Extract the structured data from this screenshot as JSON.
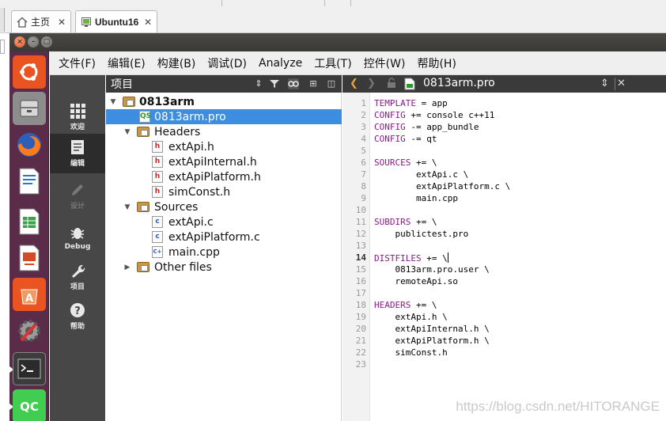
{
  "host_tabs": [
    {
      "label": "主页",
      "icon": "home-icon"
    },
    {
      "label": "Ubuntu16",
      "icon": "vm-icon"
    }
  ],
  "launcher": [
    {
      "name": "ubuntu-dash-icon",
      "color": "#e95420"
    },
    {
      "name": "files-icon",
      "color": "#8a8a8a"
    },
    {
      "name": "firefox-icon",
      "color": "#ff7b1b"
    },
    {
      "name": "writer-icon",
      "color": "#2a77c9"
    },
    {
      "name": "calc-icon",
      "color": "#3aa34a"
    },
    {
      "name": "impress-icon",
      "color": "#d44b2a"
    },
    {
      "name": "software-center-icon",
      "color": "#e95420"
    },
    {
      "name": "system-settings-icon",
      "color": "#9a9a9a"
    },
    {
      "name": "terminal-icon",
      "color": "#2b2b2b"
    },
    {
      "name": "qtcreator-icon",
      "color": "#41cd52"
    }
  ],
  "menu": [
    "文件(F)",
    "编辑(E)",
    "构建(B)",
    "调试(D)",
    "Analyze",
    "工具(T)",
    "控件(W)",
    "帮助(H)"
  ],
  "modes": [
    {
      "label": "欢迎",
      "icon": "welcome-grid-icon",
      "state": "normal"
    },
    {
      "label": "编辑",
      "icon": "edit-document-icon",
      "state": "active"
    },
    {
      "label": "设计",
      "icon": "design-pencil-icon",
      "state": "disabled"
    },
    {
      "label": "Debug",
      "icon": "debug-bug-icon",
      "state": "normal"
    },
    {
      "label": "项目",
      "icon": "projects-wrench-icon",
      "state": "normal"
    },
    {
      "label": "帮助",
      "icon": "help-question-icon",
      "state": "normal"
    }
  ],
  "project_pane": {
    "title": "项目"
  },
  "tree": [
    {
      "label": "0813arm",
      "kind": "project",
      "expanded": true,
      "bold": true
    },
    {
      "label": "0813arm.pro",
      "kind": "pro-file",
      "selected": true
    },
    {
      "label": "Headers",
      "kind": "folder",
      "expanded": true
    },
    {
      "label": "extApi.h",
      "kind": "h-file"
    },
    {
      "label": "extApiInternal.h",
      "kind": "h-file"
    },
    {
      "label": "extApiPlatform.h",
      "kind": "h-file"
    },
    {
      "label": "simConst.h",
      "kind": "h-file"
    },
    {
      "label": "Sources",
      "kind": "folder",
      "expanded": true
    },
    {
      "label": "extApi.c",
      "kind": "c-file"
    },
    {
      "label": "extApiPlatform.c",
      "kind": "c-file"
    },
    {
      "label": "main.cpp",
      "kind": "cpp-file"
    },
    {
      "label": "Other files",
      "kind": "folder",
      "expanded": false
    }
  ],
  "editor": {
    "filename": "0813arm.pro",
    "current_line": 14,
    "lines": [
      [
        {
          "t": "TEMPLATE",
          "k": true
        },
        {
          "t": " = app"
        }
      ],
      [
        {
          "t": "CONFIG",
          "k": true
        },
        {
          "t": " += console c++11"
        }
      ],
      [
        {
          "t": "CONFIG",
          "k": true
        },
        {
          "t": " -= app_bundle"
        }
      ],
      [
        {
          "t": "CONFIG",
          "k": true
        },
        {
          "t": " -= qt"
        }
      ],
      [],
      [
        {
          "t": "SOURCES",
          "k": true
        },
        {
          "t": " += \\"
        }
      ],
      [
        {
          "t": "        extApi.c \\"
        }
      ],
      [
        {
          "t": "        extApiPlatform.c \\"
        }
      ],
      [
        {
          "t": "        main.cpp"
        }
      ],
      [],
      [
        {
          "t": "SUBDIRS",
          "k": true
        },
        {
          "t": " += \\"
        }
      ],
      [
        {
          "t": "    publictest.pro"
        }
      ],
      [],
      [
        {
          "t": "DISTFILES",
          "k": true
        },
        {
          "t": " += \\"
        }
      ],
      [
        {
          "t": "    0813arm.pro.user \\"
        }
      ],
      [
        {
          "t": "    remoteApi.so"
        }
      ],
      [],
      [
        {
          "t": "HEADERS",
          "k": true
        },
        {
          "t": " += \\"
        }
      ],
      [
        {
          "t": "    extApi.h \\"
        }
      ],
      [
        {
          "t": "    extApiInternal.h \\"
        }
      ],
      [
        {
          "t": "    extApiPlatform.h \\"
        }
      ],
      [
        {
          "t": "    simConst.h"
        }
      ],
      []
    ]
  },
  "watermark": "https://blog.csdn.net/HITORANGE",
  "colors": {
    "selection": "#3d8ee0",
    "keyword": "#8b1a8b",
    "launcher_bg": "#5a2c4a"
  }
}
